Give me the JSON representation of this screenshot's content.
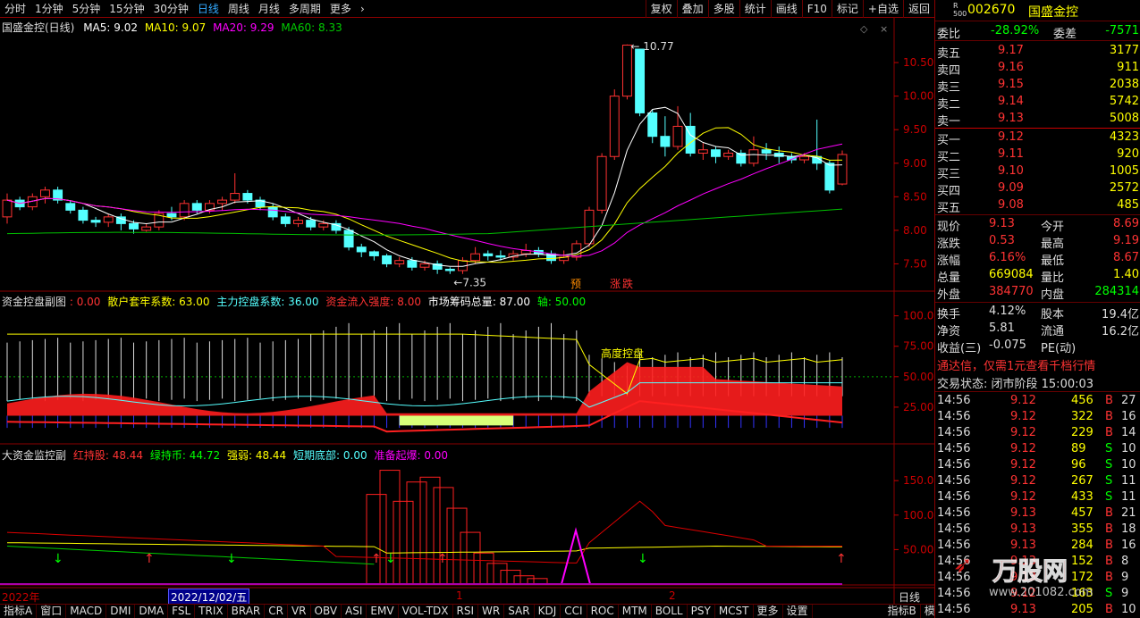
{
  "toolbar": {
    "periods": [
      "分时",
      "1分钟",
      "5分钟",
      "15分钟",
      "30分钟",
      "日线",
      "周线",
      "月线",
      "多周期",
      "更多"
    ],
    "active": "日线",
    "right": [
      "复权",
      "叠加",
      "多股",
      "统计",
      "画线",
      "F10",
      "标记",
      "+自选",
      "返回"
    ]
  },
  "main": {
    "title": "国盛金控(日线)",
    "ma5": "MA5: 9.02",
    "ma10": "MA10: 9.07",
    "ma20": "MA20: 9.29",
    "ma60": "MA60: 8.33",
    "price_labels": [
      "10.50",
      "10.00",
      "9.50",
      "9.00",
      "8.50",
      "8.00",
      "7.50"
    ],
    "high_note": "10.77",
    "low_note": "7.35",
    "tag1": "预",
    "tag2": "涨",
    "tag3": "跌"
  },
  "panel2": {
    "title": "资金控盘副图",
    "v0": ": 0.00",
    "lbl_a": "散户套牢系数",
    "val_a": ": 63.00",
    "lbl_b": "主力控盘系数",
    "val_b": ": 36.00",
    "lbl_c": "资金流入强度",
    "val_c": ": 8.00",
    "lbl_d": "市场筹码总量",
    "val_d": ": 87.00",
    "lbl_e": "轴",
    "val_e": ": 50.00",
    "axis": [
      "100.0",
      "75.00",
      "50.00",
      "25.00"
    ],
    "note": "高度控盘"
  },
  "panel3": {
    "title": "大资金监控副",
    "lbl_a": "红持股",
    "val_a": ": 48.44",
    "lbl_b": "绿持币",
    "val_b": ": 44.72",
    "lbl_c": "强弱",
    "val_c": ": 48.44",
    "lbl_d": "短期底部",
    "val_d": ": 0.00",
    "lbl_e": "准备起爆",
    "val_e": ": 0.00",
    "axis": [
      "150.0",
      "100.0",
      "50.00"
    ]
  },
  "timeline": {
    "year": "2022年",
    "cursor": "2022/12/02/五",
    "m1": "1",
    "m2": "2",
    "period": "日线"
  },
  "bottom": [
    "指标A",
    "窗口",
    "MACD",
    "DMI",
    "DMA",
    "FSL",
    "TRIX",
    "BRAR",
    "CR",
    "VR",
    "OBV",
    "ASI",
    "EMV",
    "VOL-TDX",
    "RSI",
    "WR",
    "SAR",
    "KDJ",
    "CCI",
    "ROC",
    "MTM",
    "BOLL",
    "PSY",
    "MCST",
    "更多",
    "设置",
    "指标B",
    "模板"
  ],
  "quote": {
    "code": "002670",
    "name": "国盛金控",
    "r500": "R 500",
    "weibi_l": "委比",
    "weibi": "-28.92%",
    "weicha_l": "委差",
    "weicha": "-7571",
    "asks": [
      {
        "l": "卖五",
        "p": "9.17",
        "v": "3177"
      },
      {
        "l": "卖四",
        "p": "9.16",
        "v": "911"
      },
      {
        "l": "卖三",
        "p": "9.15",
        "v": "2038"
      },
      {
        "l": "卖二",
        "p": "9.14",
        "v": "5742"
      },
      {
        "l": "卖一",
        "p": "9.13",
        "v": "5008"
      }
    ],
    "bids": [
      {
        "l": "买一",
        "p": "9.12",
        "v": "4323"
      },
      {
        "l": "买二",
        "p": "9.11",
        "v": "920"
      },
      {
        "l": "买三",
        "p": "9.10",
        "v": "1005"
      },
      {
        "l": "买四",
        "p": "9.09",
        "v": "2572"
      },
      {
        "l": "买五",
        "p": "9.08",
        "v": "485"
      }
    ],
    "stats": [
      {
        "l1": "现价",
        "v1": "9.13",
        "l2": "今开",
        "v2": "8.69"
      },
      {
        "l1": "涨跌",
        "v1": "0.53",
        "l2": "最高",
        "v2": "9.19"
      },
      {
        "l1": "涨幅",
        "v1": "6.16%",
        "l2": "最低",
        "v2": "8.67"
      },
      {
        "l1": "总量",
        "v1": "669084",
        "l2": "量比",
        "v2": "1.40"
      },
      {
        "l1": "外盘",
        "v1": "384770",
        "l2": "内盘",
        "v2": "284314"
      }
    ],
    "stats2": [
      {
        "l1": "换手",
        "v1": "4.12%",
        "l2": "股本",
        "v2": "19.4亿"
      },
      {
        "l1": "净资",
        "v1": "5.81",
        "l2": "流通",
        "v2": "16.2亿"
      },
      {
        "l1": "收益(三)",
        "v1": "-0.075",
        "l2": "PE(动)",
        "v2": ""
      }
    ],
    "ad": "通达信，仅需1元查看千档行情",
    "status": "交易状态: 闭市阶段 15:00:03",
    "ticks": [
      {
        "t": "14:56",
        "p": "9.12",
        "v": "456",
        "d": "B",
        "x": "27"
      },
      {
        "t": "14:56",
        "p": "9.12",
        "v": "322",
        "d": "B",
        "x": "16"
      },
      {
        "t": "14:56",
        "p": "9.12",
        "v": "229",
        "d": "B",
        "x": "14"
      },
      {
        "t": "14:56",
        "p": "9.12",
        "v": "89",
        "d": "S",
        "x": "10"
      },
      {
        "t": "14:56",
        "p": "9.12",
        "v": "96",
        "d": "S",
        "x": "10"
      },
      {
        "t": "14:56",
        "p": "9.12",
        "v": "267",
        "d": "S",
        "x": "11"
      },
      {
        "t": "14:56",
        "p": "9.12",
        "v": "433",
        "d": "S",
        "x": "11"
      },
      {
        "t": "14:56",
        "p": "9.13",
        "v": "457",
        "d": "B",
        "x": "21"
      },
      {
        "t": "14:56",
        "p": "9.13",
        "v": "355",
        "d": "B",
        "x": "18"
      },
      {
        "t": "14:56",
        "p": "9.13",
        "v": "284",
        "d": "B",
        "x": "16"
      },
      {
        "t": "14:56",
        "p": "9.13",
        "v": "152",
        "d": "B",
        "x": "8"
      },
      {
        "t": "14:56",
        "p": "9.13",
        "v": "172",
        "d": "B",
        "x": "9"
      },
      {
        "t": "14:56",
        "p": "9.12",
        "v": "163",
        "d": "S",
        "x": "9"
      },
      {
        "t": "14:56",
        "p": "9.13",
        "v": "205",
        "d": "B",
        "x": "10"
      },
      {
        "t": "15:00",
        "p": "9.13",
        "v": "6626",
        "d": "B",
        "x": "457"
      }
    ]
  },
  "watermark": {
    "brand": "万股网",
    "url": "www.201082.com"
  },
  "colors": {
    "up": "#ff3232",
    "down": "#54ffff",
    "ma5": "#ffffff",
    "ma10": "#ffff00",
    "ma20": "#ff00ff",
    "ma60": "#00c000",
    "grid": "#8b0000"
  },
  "chart_data": [
    {
      "type": "candlestick",
      "title": "国盛金控(日线)",
      "ylim": [
        7.2,
        10.9
      ],
      "yticks": [
        7.5,
        8.0,
        8.5,
        9.0,
        9.5,
        10.0,
        10.5
      ],
      "candles": [
        [
          8.2,
          8.45,
          8.1,
          8.55
        ],
        [
          8.45,
          8.35,
          8.3,
          8.5
        ],
        [
          8.35,
          8.5,
          8.3,
          8.55
        ],
        [
          8.5,
          8.6,
          8.4,
          8.65
        ],
        [
          8.6,
          8.45,
          8.4,
          8.65
        ],
        [
          8.4,
          8.3,
          8.25,
          8.45
        ],
        [
          8.3,
          8.15,
          8.1,
          8.35
        ],
        [
          8.15,
          8.12,
          8.05,
          8.2
        ],
        [
          8.12,
          8.2,
          8.05,
          8.25
        ],
        [
          8.2,
          8.1,
          8.0,
          8.25
        ],
        [
          8.1,
          8.02,
          7.95,
          8.15
        ],
        [
          8.0,
          8.05,
          7.98,
          8.1
        ],
        [
          8.05,
          8.25,
          8.0,
          8.3
        ],
        [
          8.25,
          8.2,
          8.15,
          8.35
        ],
        [
          8.2,
          8.4,
          8.15,
          8.45
        ],
        [
          8.4,
          8.3,
          8.25,
          8.45
        ],
        [
          8.3,
          8.4,
          8.25,
          8.45
        ],
        [
          8.4,
          8.45,
          8.3,
          8.5
        ],
        [
          8.45,
          8.55,
          8.4,
          8.85
        ],
        [
          8.55,
          8.45,
          8.4,
          8.6
        ],
        [
          8.45,
          8.35,
          8.3,
          8.5
        ],
        [
          8.35,
          8.2,
          8.15,
          8.4
        ],
        [
          8.2,
          8.1,
          8.05,
          8.25
        ],
        [
          8.1,
          8.15,
          8.05,
          8.2
        ],
        [
          8.15,
          8.05,
          8.0,
          8.2
        ],
        [
          8.05,
          8.1,
          8.0,
          8.15
        ],
        [
          8.1,
          8.0,
          7.95,
          8.15
        ],
        [
          8.0,
          7.75,
          7.7,
          8.05
        ],
        [
          7.75,
          7.68,
          7.6,
          7.8
        ],
        [
          7.68,
          7.62,
          7.55,
          7.7
        ],
        [
          7.62,
          7.5,
          7.45,
          7.65
        ],
        [
          7.5,
          7.55,
          7.45,
          7.6
        ],
        [
          7.55,
          7.45,
          7.4,
          7.6
        ],
        [
          7.45,
          7.5,
          7.4,
          7.55
        ],
        [
          7.5,
          7.42,
          7.35,
          7.55
        ],
        [
          7.42,
          7.4,
          7.35,
          7.45
        ],
        [
          7.4,
          7.55,
          7.35,
          7.6
        ],
        [
          7.55,
          7.65,
          7.5,
          7.75
        ],
        [
          7.65,
          7.62,
          7.55,
          7.7
        ],
        [
          7.62,
          7.6,
          7.55,
          7.7
        ],
        [
          7.6,
          7.65,
          7.55,
          7.7
        ],
        [
          7.65,
          7.7,
          7.6,
          7.8
        ],
        [
          7.7,
          7.65,
          7.6,
          7.75
        ],
        [
          7.65,
          7.55,
          7.5,
          7.7
        ],
        [
          7.55,
          7.6,
          7.5,
          7.7
        ],
        [
          7.6,
          7.8,
          7.55,
          7.85
        ],
        [
          7.8,
          8.3,
          7.75,
          8.35
        ],
        [
          8.3,
          9.1,
          8.25,
          9.15
        ],
        [
          9.1,
          10.0,
          9.05,
          10.1
        ],
        [
          10.0,
          10.76,
          9.95,
          10.77
        ],
        [
          10.7,
          9.75,
          9.7,
          10.7
        ],
        [
          9.75,
          9.4,
          9.3,
          9.8
        ],
        [
          9.4,
          9.25,
          9.1,
          9.7
        ],
        [
          9.25,
          9.55,
          9.2,
          9.85
        ],
        [
          9.55,
          9.15,
          9.1,
          9.75
        ],
        [
          9.15,
          9.2,
          9.05,
          9.3
        ],
        [
          9.2,
          9.1,
          9.0,
          9.25
        ],
        [
          9.1,
          9.15,
          9.05,
          9.2
        ],
        [
          9.15,
          9.0,
          8.95,
          9.2
        ],
        [
          9.0,
          9.2,
          8.95,
          9.4
        ],
        [
          9.2,
          9.15,
          9.05,
          9.3
        ],
        [
          9.15,
          9.1,
          9.0,
          9.25
        ],
        [
          9.1,
          9.05,
          9.0,
          9.15
        ],
        [
          9.05,
          9.1,
          9.0,
          9.15
        ],
        [
          9.1,
          9.0,
          8.9,
          9.65
        ],
        [
          9.0,
          8.6,
          8.55,
          9.05
        ],
        [
          8.69,
          9.13,
          8.67,
          9.19
        ]
      ]
    },
    {
      "type": "line",
      "title": "资金控盘副图",
      "ylim": [
        0,
        110
      ],
      "yticks": [
        25,
        50,
        75,
        100
      ]
    },
    {
      "type": "bar",
      "title": "大资金监控副",
      "ylim": [
        0,
        180
      ],
      "yticks": [
        50,
        100,
        150
      ]
    }
  ]
}
